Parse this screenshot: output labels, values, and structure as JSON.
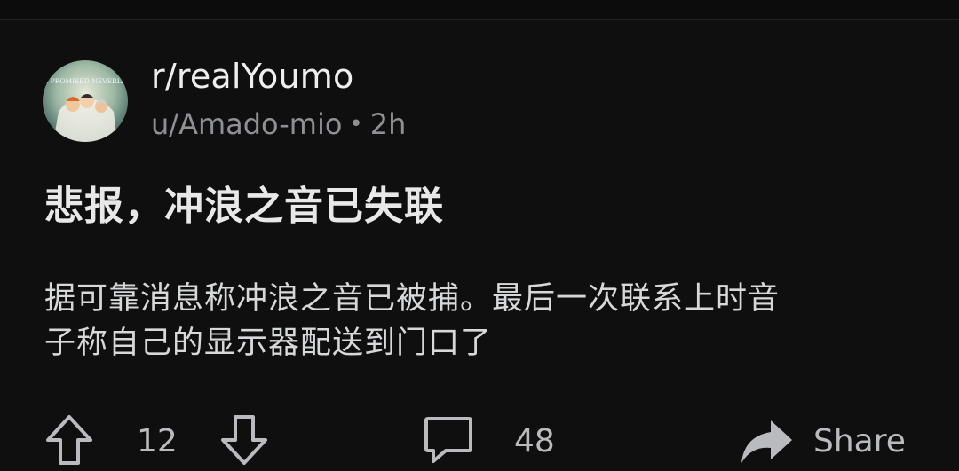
{
  "post": {
    "subreddit": "r/realYoumo",
    "author": "u/Amado-mio",
    "separator": "•",
    "time": "2h",
    "avatar_text": "THE PROMISED NEVERLAND",
    "title": "悲报，冲浪之音已失联",
    "body_lines": [
      "据可靠消息称冲浪之音已被捕。最后一次联系上时音",
      "子称自己的显示器配送到门口了"
    ]
  },
  "actions": {
    "upvote_icon": "arrow-up-icon",
    "score": "12",
    "downvote_icon": "arrow-down-icon",
    "comment_icon": "comment-bubble-icon",
    "comments": "48",
    "share_icon": "share-arrow-icon",
    "share_label": "Share"
  },
  "colors": {
    "background": "#0f0f0f",
    "text_primary": "#d7dadc",
    "text_muted": "#8e9093",
    "icon": "#b9bbbe"
  }
}
